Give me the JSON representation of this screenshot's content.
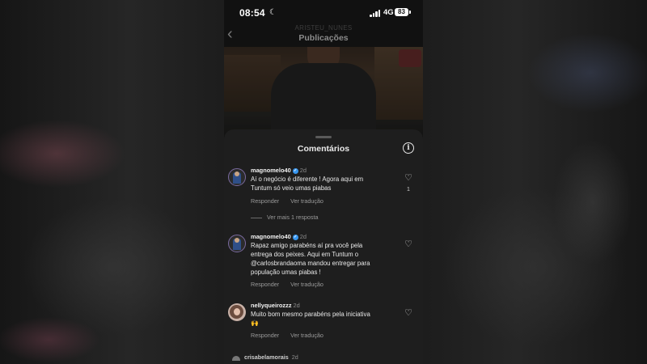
{
  "status_bar": {
    "time": "08:54",
    "network": "4G",
    "battery": "83"
  },
  "header": {
    "username": "ARISTEU_NUNES",
    "title": "Publicações"
  },
  "sheet": {
    "title": "Comentários"
  },
  "comments": [
    {
      "author": "magnomelo40",
      "age": "2d",
      "text": "Aí o negócio é diferente ! Agora aqui em\nTuntum só veio umas piabas",
      "reply": "Responder",
      "translate": "Ver tradução",
      "likes": "1",
      "more_replies": "Ver mais 1 resposta"
    },
    {
      "author": "magnomelo40",
      "age": "2d",
      "text": "Rapaz amigo parabéns aí pra você pela\nentrega dos peixes.  Aqui em Tuntum o\n@carlosbrandaoma mandou entregar para\npopulação umas piabas !",
      "reply": "Responder",
      "translate": "Ver tradução"
    },
    {
      "author": "nellyqueirozzz",
      "age": "2d",
      "text": "Muito bom mesmo parabéns pela iniciativa\n🙌",
      "reply": "Responder",
      "translate": "Ver tradução"
    }
  ],
  "partial_comment": {
    "author": "crisabelamorais",
    "age": "2d"
  },
  "icons": {
    "back": "chevron-left-icon",
    "info": "info-icon",
    "like": "heart-icon",
    "verified": "verified-badge-icon",
    "moon": "moon-icon",
    "signal": "signal-icon",
    "battery": "battery-icon"
  }
}
